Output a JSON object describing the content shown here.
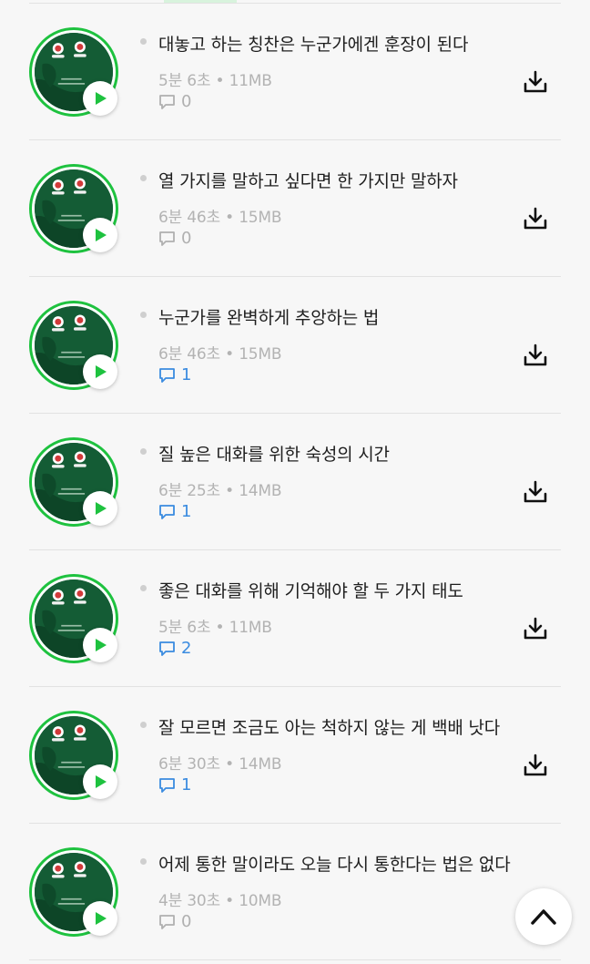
{
  "episodes": [
    {
      "title": "대놓고 하는 칭찬은 누군가에겐 훈장이 된다",
      "duration": "5분 6초",
      "size": "11MB",
      "comments": "0",
      "has_comments": false
    },
    {
      "title": "열 가지를 말하고 싶다면 한 가지만 말하자",
      "duration": "6분 46초",
      "size": "15MB",
      "comments": "0",
      "has_comments": false
    },
    {
      "title": "누군가를 완벽하게 추앙하는 법",
      "duration": "6분 46초",
      "size": "15MB",
      "comments": "1",
      "has_comments": true
    },
    {
      "title": "질 높은 대화를 위한 숙성의 시간",
      "duration": "6분 25초",
      "size": "14MB",
      "comments": "1",
      "has_comments": true
    },
    {
      "title": "좋은 대화를 위해 기억해야 할 두 가지 태도",
      "duration": "5분 6초",
      "size": "11MB",
      "comments": "2",
      "has_comments": true
    },
    {
      "title": "잘 모르면 조금도 아는 척하지 않는 게 백배 낫다",
      "duration": "6분 30초",
      "size": "14MB",
      "comments": "1",
      "has_comments": true
    },
    {
      "title": "어제 통한 말이라도 오늘 다시 통한다는 법은 없다",
      "duration": "4분 30초",
      "size": "10MB",
      "comments": "0",
      "has_comments": false
    }
  ],
  "meta_separator": "•",
  "icons": {
    "play": "play-icon",
    "comment": "comment-icon",
    "download": "download-icon",
    "scroll_top": "chevron-up-icon"
  },
  "colors": {
    "accent_green": "#1ec23f",
    "comment_active": "#3a8be0",
    "muted": "#b3b3b3"
  }
}
